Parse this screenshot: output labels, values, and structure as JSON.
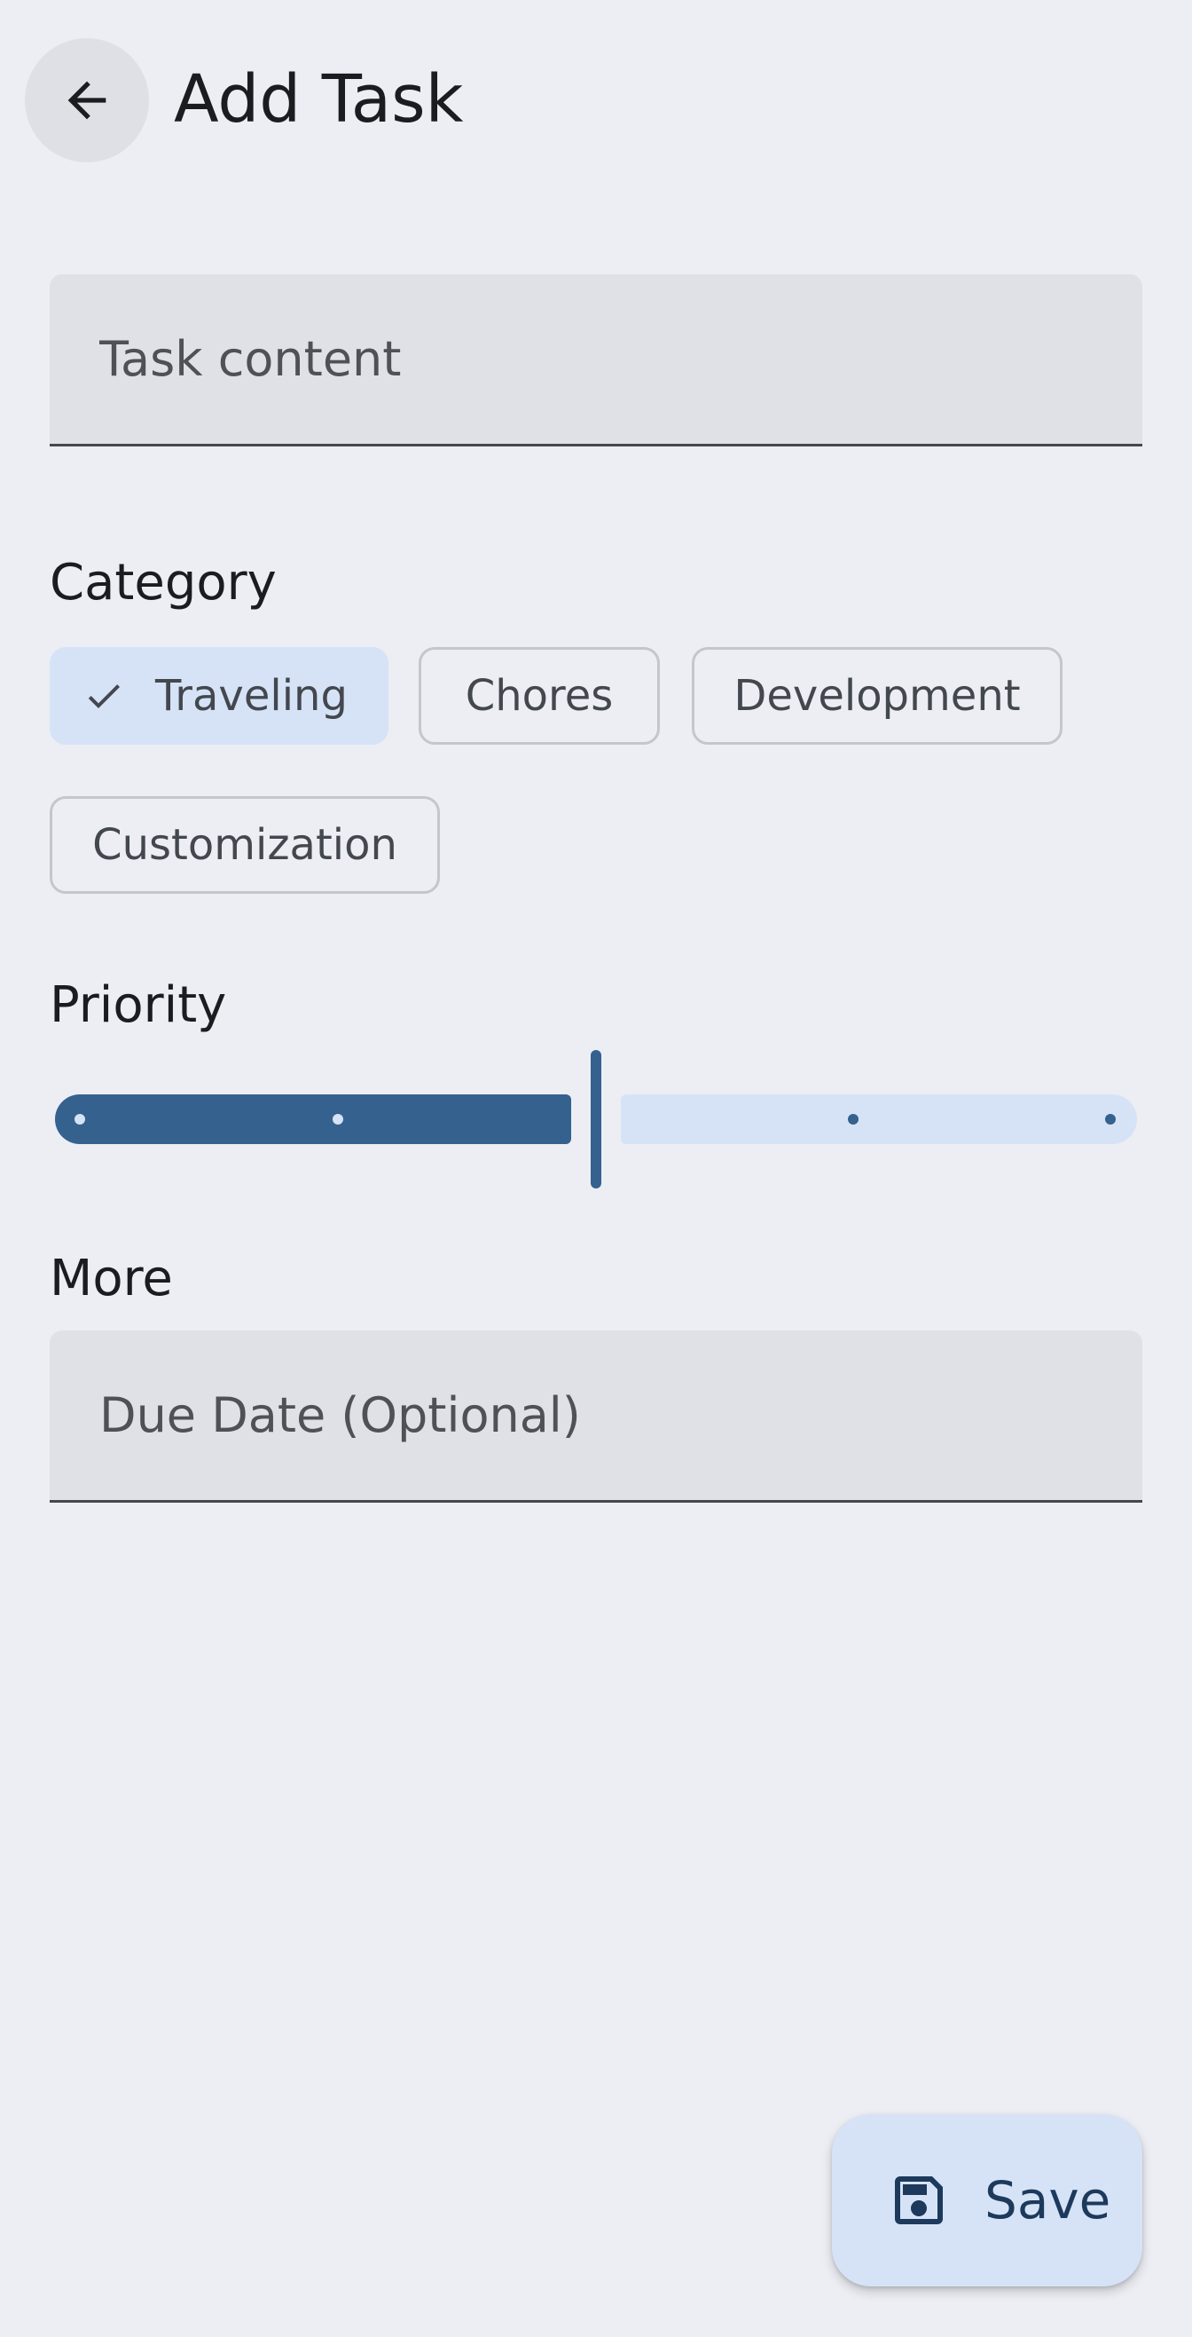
{
  "header": {
    "title": "Add Task",
    "back_icon": "arrow-back-icon"
  },
  "task_content": {
    "value": "",
    "placeholder": "Task content"
  },
  "category": {
    "label": "Category",
    "chips": [
      {
        "label": "Traveling",
        "selected": true
      },
      {
        "label": "Chores",
        "selected": false
      },
      {
        "label": "Development",
        "selected": false
      },
      {
        "label": "Customization",
        "selected": false
      }
    ]
  },
  "priority": {
    "label": "Priority",
    "value": 2,
    "min": 0,
    "max": 4,
    "steps": 5
  },
  "more": {
    "label": "More",
    "due_date": {
      "value": "",
      "placeholder": "Due Date (Optional)"
    }
  },
  "fab": {
    "label": "Save",
    "icon": "save-icon"
  },
  "colors": {
    "background": "#eceef4",
    "primary": "#35618e",
    "primary_container": "#d6e3f7",
    "field_fill": "#e0e1e6",
    "on_surface": "#1a1c20",
    "outline": "#c4c6cd"
  }
}
